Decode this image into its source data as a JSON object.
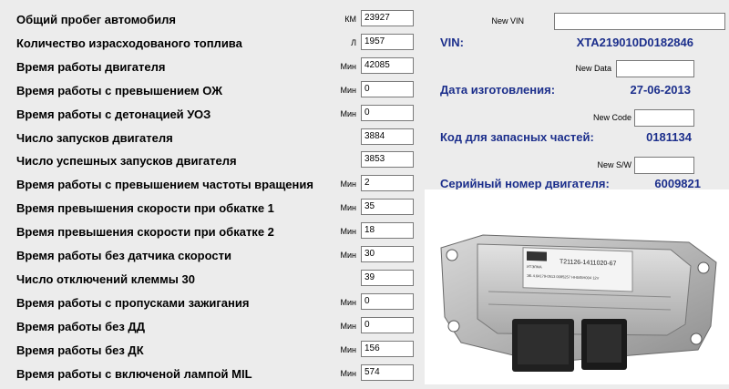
{
  "rows": [
    {
      "label": "Общий пробег автомобиля",
      "unit": "КМ",
      "value": "23927"
    },
    {
      "label": "Количество израсходованого топлива",
      "unit": "Л",
      "value": "1957"
    },
    {
      "label": "Время работы двигателя",
      "unit": "Мин",
      "value": "42085"
    },
    {
      "label": "Время работы с превышением  ОЖ",
      "unit": "Мин",
      "value": "0"
    },
    {
      "label": "Время работы с детонацией  УОЗ",
      "unit": "Мин",
      "value": "0"
    },
    {
      "label": "Число запусков двигателя",
      "unit": "",
      "value": "3884"
    },
    {
      "label": "Число успешных запусков двигателя",
      "unit": "",
      "value": "3853"
    },
    {
      "label": "Время работы с превышением частоты вращения",
      "unit": "Мин",
      "value": "2"
    },
    {
      "label": "Время превышения скорости при обкатке  1",
      "unit": "Мин",
      "value": "35"
    },
    {
      "label": "Время превышения скорости при обкатке  2",
      "unit": "Мин",
      "value": "18"
    },
    {
      "label": "Время работы без датчика скорости",
      "unit": "Мин",
      "value": "30"
    },
    {
      "label": "Число отключений клеммы  30",
      "unit": "",
      "value": "39"
    },
    {
      "label": "Время работы с пропусками зажигания",
      "unit": "Мин",
      "value": "0"
    },
    {
      "label": "Время работы без  ДД",
      "unit": "Мин",
      "value": "0"
    },
    {
      "label": "Время работы без  ДК",
      "unit": "Мин",
      "value": "156"
    },
    {
      "label": "Время работы с включеной лампой MIL",
      "unit": "Мин",
      "value": "574"
    }
  ],
  "right": {
    "new_vin_label": "New VIN",
    "new_vin_value": "",
    "vin_label": "VIN:",
    "vin_value": "XTA219010D0182846",
    "new_data_label": "New Data",
    "new_data_value": "",
    "date_label": "Дата изготовления:",
    "date_value": "27-06-2013",
    "new_code_label": "New Code",
    "new_code_value": "",
    "code_label": "Код для запасных частей:",
    "code_value": "0181134",
    "new_sw_label": "New S/W",
    "new_sw_value": "",
    "serial_label": "Серийный номер двигателя:",
    "serial_value": "6009821"
  },
  "ecu_photo": {
    "label_main": "T21126-1411020-67",
    "label_line2": "ЭБ 4.64179-0513  0095257  НН045Н004 12V",
    "brand": "ИТЭЛМА"
  },
  "colors": {
    "background": "#ececec",
    "accent_blue": "#1c2f8c"
  }
}
